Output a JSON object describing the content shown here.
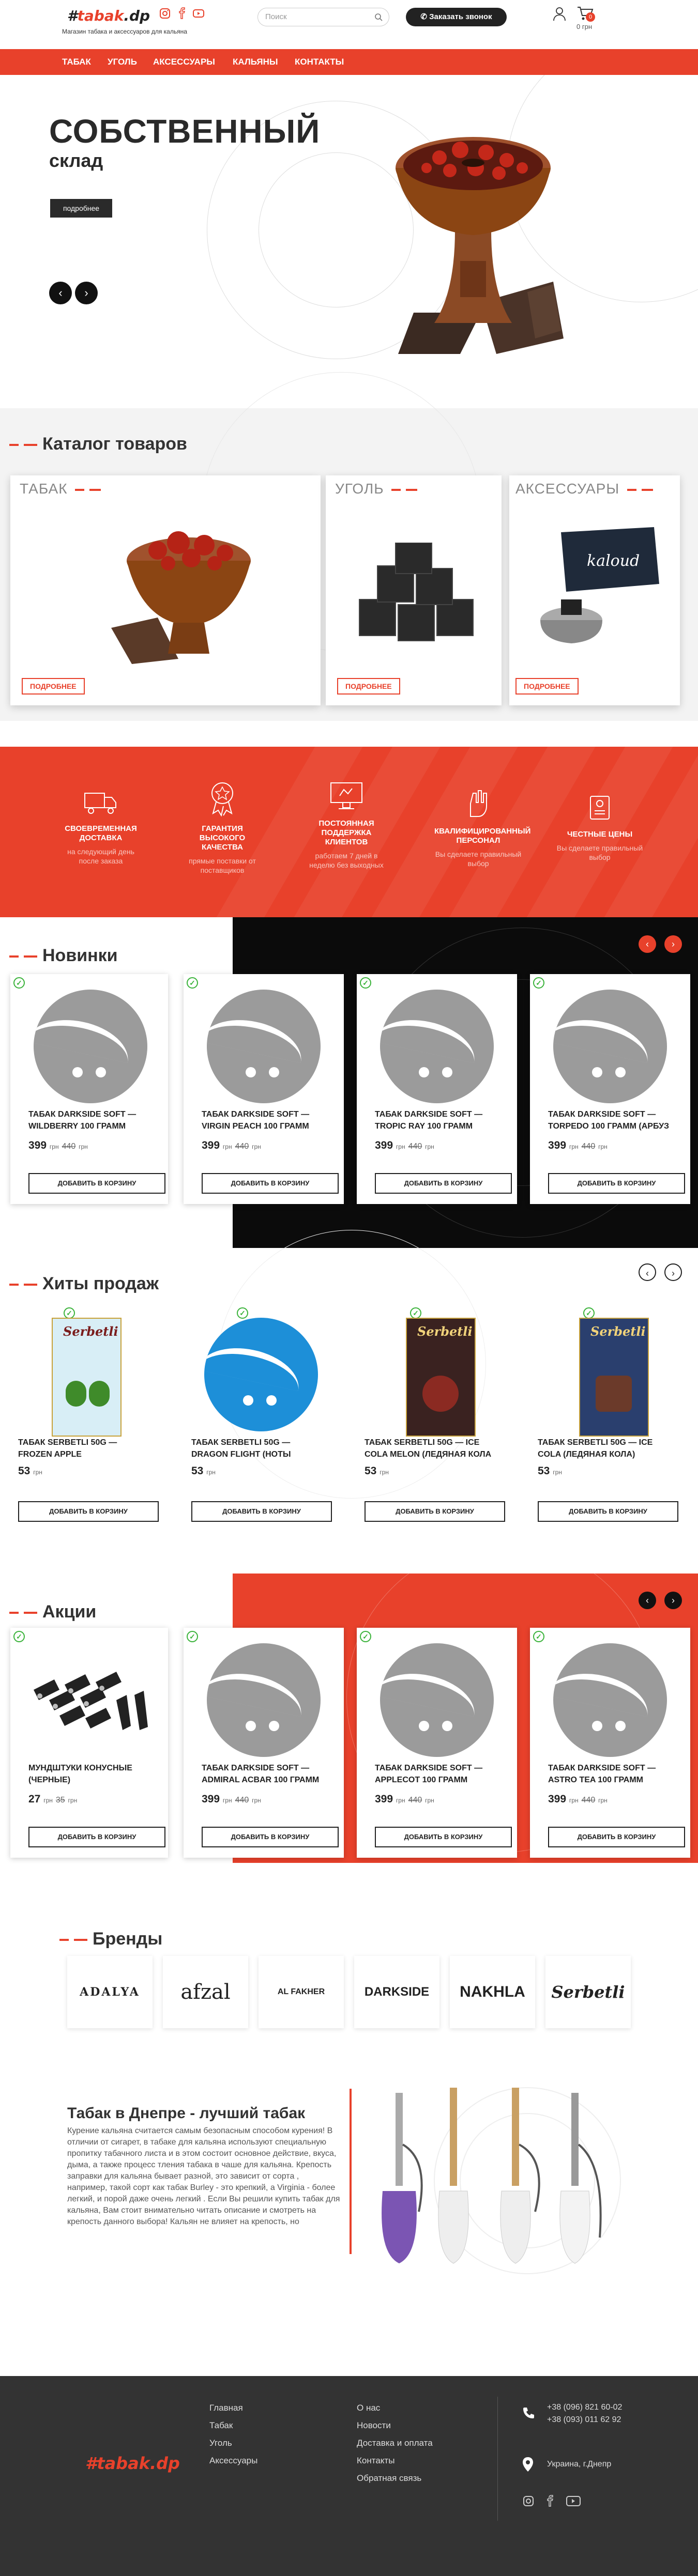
{
  "header": {
    "logo_hash": "#",
    "logo_word": "tabak",
    "logo_suffix": ".dp",
    "tagline": "Магазин табака и аксессуаров для кальяна",
    "search_placeholder": "Поиск",
    "call_button": "Заказать звонок",
    "cart_count": "0",
    "cart_total": "0 грн"
  },
  "nav": {
    "items": [
      "ТАБАК",
      "УГОЛЬ",
      "АКСЕССУАРЫ",
      "КАЛЬЯНЫ",
      "КОНТАКТЫ"
    ]
  },
  "hero": {
    "title": "СОБСТВЕННЫЙ",
    "subtitle": "склад",
    "button": "подробнее",
    "prev": "‹",
    "next": "›"
  },
  "catalog": {
    "title": "Каталог товаров",
    "cards": [
      {
        "title": "ТАБАК",
        "button": "ПОДРОБНЕЕ"
      },
      {
        "title": "УГОЛЬ",
        "button": "ПОДРОБНЕЕ"
      },
      {
        "title": "АКСЕССУАРЫ",
        "button": "ПОДРОБНЕЕ"
      }
    ]
  },
  "features": [
    {
      "icon": "truck-icon",
      "title": "СВОЕВРЕМЕННАЯ ДОСТАВКА",
      "text": "на следующий день после заказа"
    },
    {
      "icon": "medal-icon",
      "title": "ГАРАНТИЯ ВЫСОКОГО КАЧЕСТВА",
      "text": "прямые поставки от поставщиков"
    },
    {
      "icon": "monitor-icon",
      "title": "ПОСТОЯННАЯ ПОДДЕРЖКА КЛИЕНТОВ",
      "text": "работаем 7 дней в неделю без выходных"
    },
    {
      "icon": "hand-icon",
      "title": "КВАЛИФИЦИРОВАННЫЙ ПЕРСОНАЛ",
      "text": "Вы сделаете правильный выбор"
    },
    {
      "icon": "price-tag-icon",
      "title": "ЧЕСТНЫЕ ЦЕНЫ",
      "text": "Вы сделаете правильный выбор"
    }
  ],
  "new_items": {
    "title": "Новинки",
    "products": [
      {
        "name": "ТАБАК DARKSIDE SOFT — WILDBERRY 100 ГРАММ",
        "price": "399",
        "currency": "грн",
        "old_price": "440",
        "old_currency": "грн",
        "button": "ДОБАВИТЬ В КОРЗИНУ"
      },
      {
        "name": "ТАБАК DARKSIDE SOFT — VIRGIN PEACH 100 ГРАММ",
        "price": "399",
        "currency": "грн",
        "old_price": "440",
        "old_currency": "грн",
        "button": "ДОБАВИТЬ В КОРЗИНУ"
      },
      {
        "name": "ТАБАК DARKSIDE SOFT — TROPIC RAY 100 ГРАММ",
        "price": "399",
        "currency": "грн",
        "old_price": "440",
        "old_currency": "грн",
        "button": "ДОБАВИТЬ В КОРЗИНУ"
      },
      {
        "name": "ТАБАК DARKSIDE SOFT — TORPEDO 100 ГРАММ (АРБУЗ",
        "price": "399",
        "currency": "грн",
        "old_price": "440",
        "old_currency": "грн",
        "button": "ДОБАВИТЬ В КОРЗИНУ"
      }
    ]
  },
  "hits": {
    "title": "Хиты продаж",
    "products": [
      {
        "name": "ТАБАК SERBETLI 50G — FROZEN APPLE",
        "price": "53",
        "currency": "грн",
        "button": "ДОБАВИТЬ В КОРЗИНУ"
      },
      {
        "name": "ТАБАК SERBETLI 50G — DRAGON FLIGHT (НОТЫ",
        "price": "53",
        "currency": "грн",
        "button": "ДОБАВИТЬ В КОРЗИНУ"
      },
      {
        "name": "ТАБАК SERBETLI 50G — ICE COLA MELON (ЛЕДЯНАЯ КОЛА",
        "price": "53",
        "currency": "грн",
        "button": "ДОБАВИТЬ В КОРЗИНУ"
      },
      {
        "name": "ТАБАК SERBETLI 50G — ICE COLA (ЛЕДЯНАЯ КОЛА)",
        "price": "53",
        "currency": "грн",
        "button": "ДОБАВИТЬ В КОРЗИНУ"
      }
    ]
  },
  "sales": {
    "title": "Акции",
    "products": [
      {
        "name": "МУНДШТУКИ КОНУСНЫЕ (ЧЕРНЫЕ)",
        "price": "27",
        "currency": "грн",
        "old_price": "35",
        "old_currency": "грн",
        "button": "ДОБАВИТЬ В КОРЗИНУ"
      },
      {
        "name": "ТАБАК DARKSIDE SOFT — ADMIRAL ACBAR 100 ГРАММ",
        "price": "399",
        "currency": "грн",
        "old_price": "440",
        "old_currency": "грн",
        "button": "ДОБАВИТЬ В КОРЗИНУ"
      },
      {
        "name": "ТАБАК DARKSIDE SOFT — APPLECOT 100 ГРАММ",
        "price": "399",
        "currency": "грн",
        "old_price": "440",
        "old_currency": "грн",
        "button": "ДОБАВИТЬ В КОРЗИНУ"
      },
      {
        "name": "ТАБАК DARKSIDE SOFT — ASTRO TEA 100 ГРАММ",
        "price": "399",
        "currency": "грн",
        "old_price": "440",
        "old_currency": "грн",
        "button": "ДОБАВИТЬ В КОРЗИНУ"
      }
    ]
  },
  "brands": {
    "title": "Бренды",
    "items": [
      "ADALYA",
      "afzal",
      "AL FAKHER",
      "DARKSIDE",
      "NAKHLA",
      "Serbetli"
    ]
  },
  "about": {
    "title": "Табак в Днепре - лучший табак",
    "text": "Курение кальяна считается самым безопасным способом курения! В отличии от сигарет, в табаке для кальяна используют специальную пропитку табачного листа и в этом состоит основное действие, вкуса, дыма, а также процесс тления табака в чаше для кальяна. Крепость заправки для кальяна бывает разной, это зависит от сорта , например, такой сорт как табак Burley - это крепкий, а Virginia - более легкий, и порой даже очень легкий . Если Вы решили купить табак для кальяна, Вам стоит внимательно читать описание и смотреть на крепость данного выбора! Кальян не влияет на крепость, но"
  },
  "footer": {
    "col1": [
      "Главная",
      "Табак",
      "Уголь",
      "Аксессуары"
    ],
    "col2": [
      "О нас",
      "Новости",
      "Доставка и оплата",
      "Контакты",
      "Обратная связь"
    ],
    "phones": [
      "+38 (096) 821 60-02",
      "+38 (093) 011 62 92"
    ],
    "address": "Украина, г.Днепр"
  },
  "colors": {
    "accent": "#e8412b",
    "dark": "#222222",
    "footer": "#333333"
  }
}
